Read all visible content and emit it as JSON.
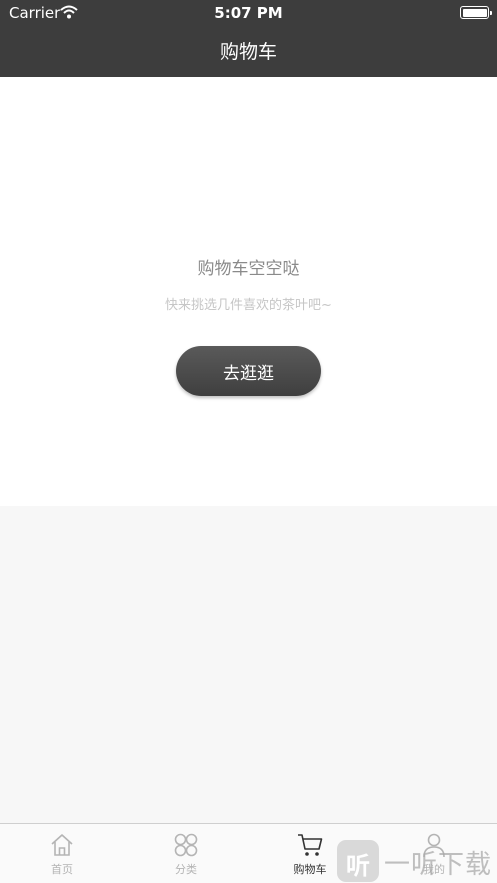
{
  "status_bar": {
    "carrier": "Carrier",
    "time": "5:07 PM",
    "wifi_icon": "wifi-icon",
    "battery_icon": "battery-icon"
  },
  "nav": {
    "title": "购物车"
  },
  "empty_state": {
    "title": "购物车空空哒",
    "subtitle": "快来挑选几件喜欢的茶叶吧~",
    "button_label": "去逛逛"
  },
  "tabbar": {
    "tabs": [
      {
        "label": "首页",
        "icon": "home-icon",
        "active": false
      },
      {
        "label": "分类",
        "icon": "category-icon",
        "active": false
      },
      {
        "label": "购物车",
        "icon": "cart-icon",
        "active": true
      },
      {
        "label": "我的",
        "icon": "user-icon",
        "active": false
      }
    ]
  },
  "watermark": {
    "logo_text": "听",
    "text": "一听下载"
  },
  "colors": {
    "header_bg": "#3d3d3d",
    "button_bg": "#4a4a4a",
    "tab_active": "#333333",
    "tab_inactive": "#b4b4b4"
  }
}
